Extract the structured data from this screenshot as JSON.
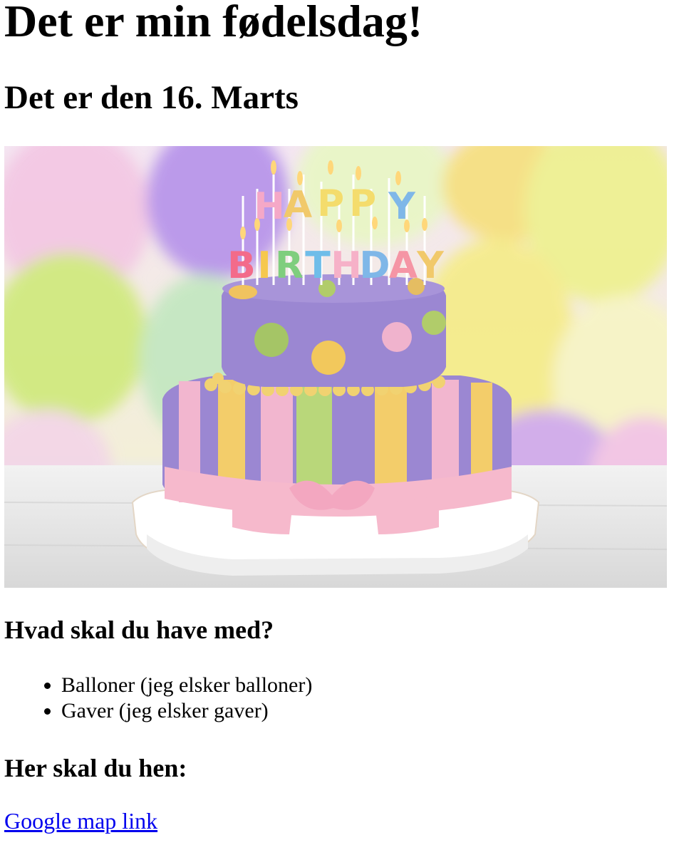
{
  "heading": "Det er min fødelsdag!",
  "date_heading": "Det er den 16. Marts",
  "cake_image": {
    "alt": "Fødselsdagskage",
    "candle_text": "HAPPY BIRTHDAY",
    "colors": {
      "cake_purple": "#9b87d2",
      "stripe_pink": "#f2b6cf",
      "stripe_yellow": "#f3cd6a",
      "stripe_green": "#b9d77a",
      "ribbon_pink": "#f6b9cc",
      "balloon_yellow": "#f2f08a",
      "balloon_purple": "#b49ae6"
    }
  },
  "bring_heading": "Hvad skal du have med?",
  "bring_items": [
    "Balloner (jeg elsker balloner)",
    "Gaver (jeg elsker gaver)"
  ],
  "where_heading": "Her skal du hen:",
  "map_link": {
    "label": "Google map link"
  },
  "colors": {
    "link": "#0000ee",
    "text": "#000000",
    "background": "#ffffff"
  }
}
